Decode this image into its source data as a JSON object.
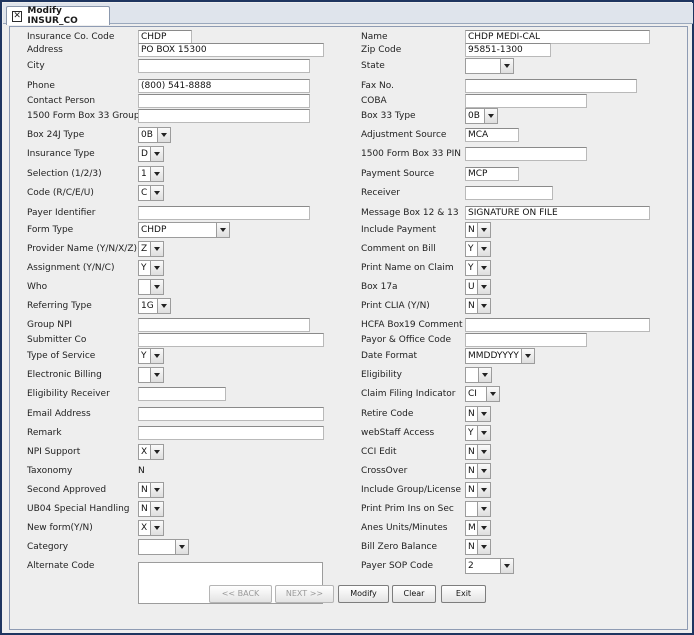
{
  "tab": {
    "title": "Modify INSUR_CO",
    "close_glyph": "✕"
  },
  "left": [
    {
      "label": "Insurance Co. Code",
      "kind": "text",
      "value": "CHDP"
    },
    {
      "label": "Address",
      "kind": "text",
      "value": "PO BOX 15300"
    },
    {
      "label": "City",
      "kind": "text",
      "value": ""
    },
    {
      "label": "Phone",
      "kind": "text",
      "value": "(800) 541-8888"
    },
    {
      "label": "Contact Person",
      "kind": "text",
      "value": ""
    },
    {
      "label": "1500 Form Box 33 Group",
      "kind": "text",
      "value": ""
    },
    {
      "label": "Box 24J Type",
      "kind": "combo",
      "value": "0B"
    },
    {
      "label": "Insurance Type",
      "kind": "combo",
      "value": "D"
    },
    {
      "label": "Selection (1/2/3)",
      "kind": "combo",
      "value": "1"
    },
    {
      "label": "Code (R/C/E/U)",
      "kind": "combo",
      "value": "C"
    },
    {
      "label": "Payer Identifier",
      "kind": "text",
      "value": ""
    },
    {
      "label": "Form Type",
      "kind": "combo",
      "value": "CHDP"
    },
    {
      "label": "Provider Name (Y/N/X/Z)",
      "kind": "combo",
      "value": "Z"
    },
    {
      "label": "Assignment (Y/N/C)",
      "kind": "combo",
      "value": "Y"
    },
    {
      "label": "Who",
      "kind": "combo",
      "value": ""
    },
    {
      "label": "Referring Type",
      "kind": "combo",
      "value": "1G"
    },
    {
      "label": "Group NPI",
      "kind": "text",
      "value": ""
    },
    {
      "label": "Submitter Co",
      "kind": "text",
      "value": ""
    },
    {
      "label": "Type of Service",
      "kind": "combo",
      "value": "Y"
    },
    {
      "label": "Electronic Billing",
      "kind": "combo",
      "value": ""
    },
    {
      "label": "Eligibility Receiver",
      "kind": "text",
      "value": ""
    },
    {
      "label": "Email Address",
      "kind": "text",
      "value": ""
    },
    {
      "label": "Remark",
      "kind": "text",
      "value": ""
    },
    {
      "label": "NPI Support",
      "kind": "combo",
      "value": "X"
    },
    {
      "label": "Taxonomy",
      "kind": "static",
      "value": "N"
    },
    {
      "label": "Second Approved",
      "kind": "combo",
      "value": "N"
    },
    {
      "label": "UB04 Special Handling",
      "kind": "combo",
      "value": "N"
    },
    {
      "label": "New form(Y/N)",
      "kind": "combo",
      "value": "X"
    },
    {
      "label": "Category",
      "kind": "combo",
      "value": ""
    },
    {
      "label": "Alternate Code",
      "kind": "textarea",
      "value": ""
    }
  ],
  "right": [
    {
      "label": "Name",
      "kind": "text",
      "value": "CHDP MEDI-CAL"
    },
    {
      "label": "Zip Code",
      "kind": "text",
      "value": "95851-1300"
    },
    {
      "label": "State",
      "kind": "combo",
      "value": ""
    },
    {
      "label": "Fax No.",
      "kind": "text",
      "value": ""
    },
    {
      "label": "COBA",
      "kind": "text",
      "value": ""
    },
    {
      "label": "Box 33 Type",
      "kind": "combo",
      "value": "0B"
    },
    {
      "label": "Adjustment Source",
      "kind": "text",
      "value": "MCA"
    },
    {
      "label": "1500 Form Box 33 PIN",
      "kind": "text",
      "value": ""
    },
    {
      "label": "Payment Source",
      "kind": "text",
      "value": "MCP"
    },
    {
      "label": "Receiver",
      "kind": "text",
      "value": ""
    },
    {
      "label": "Message Box 12 & 13",
      "kind": "text",
      "value": "SIGNATURE ON FILE"
    },
    {
      "label": "Include Payment",
      "kind": "combo",
      "value": "N"
    },
    {
      "label": "Comment on Bill",
      "kind": "combo",
      "value": "Y"
    },
    {
      "label": "Print Name on Claim",
      "kind": "combo",
      "value": "Y"
    },
    {
      "label": "Box 17a",
      "kind": "combo",
      "value": "U"
    },
    {
      "label": "Print CLIA (Y/N)",
      "kind": "combo",
      "value": "N"
    },
    {
      "label": "HCFA Box19 Comment",
      "kind": "text",
      "value": ""
    },
    {
      "label": "Payor & Office Code",
      "kind": "text",
      "value": ""
    },
    {
      "label": "Date Format",
      "kind": "combo",
      "value": "MMDDYYYY"
    },
    {
      "label": "Eligibility",
      "kind": "combo",
      "value": ""
    },
    {
      "label": "Claim Filing Indicator",
      "kind": "combo",
      "value": "CI"
    },
    {
      "label": "Retire Code",
      "kind": "combo",
      "value": "N"
    },
    {
      "label": "webStaff Access",
      "kind": "combo",
      "value": "Y"
    },
    {
      "label": "CCI Edit",
      "kind": "combo",
      "value": "N"
    },
    {
      "label": "CrossOver",
      "kind": "combo",
      "value": "N"
    },
    {
      "label": "Include Group/License",
      "kind": "combo",
      "value": "N"
    },
    {
      "label": "Print Prim Ins on Sec",
      "kind": "combo",
      "value": ""
    },
    {
      "label": "Anes Units/Minutes",
      "kind": "combo",
      "value": "M"
    },
    {
      "label": "Bill Zero Balance",
      "kind": "combo",
      "value": "N"
    },
    {
      "label": "Payer SOP Code",
      "kind": "combo",
      "value": "2"
    }
  ],
  "buttons": [
    {
      "label": "<< BACK",
      "enabled": false
    },
    {
      "label": "NEXT >>",
      "enabled": false
    },
    {
      "label": "Modify",
      "enabled": true
    },
    {
      "label": "Clear",
      "enabled": true
    },
    {
      "label": "Exit",
      "enabled": true
    }
  ]
}
